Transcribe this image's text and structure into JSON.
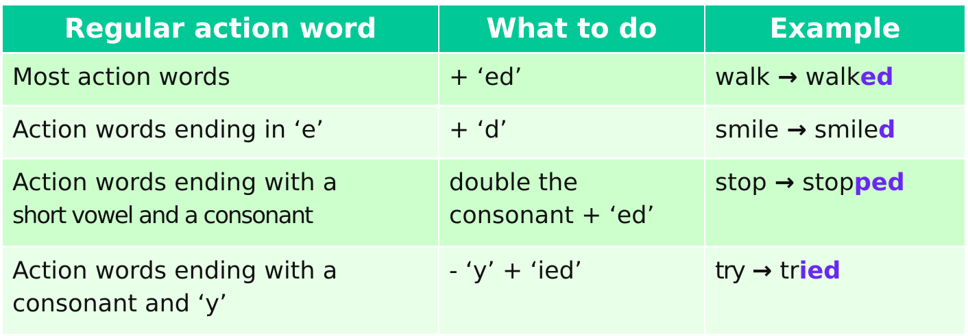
{
  "table": {
    "headers": [
      "Regular action word",
      "What to do",
      "Example"
    ],
    "rows": [
      {
        "word_lines": [
          "Most action words"
        ],
        "todo_lines": [
          "+ ‘ed’"
        ],
        "example": {
          "base": "walk",
          "arrow": "→",
          "stem": "walk",
          "suffix": "ed"
        }
      },
      {
        "word_lines": [
          "Action words ending in ‘e’"
        ],
        "todo_lines": [
          "+ ‘d’"
        ],
        "example": {
          "base": "smile",
          "arrow": "→",
          "stem": "smile",
          "suffix": "d"
        }
      },
      {
        "word_lines": [
          "Action words ending with a",
          "short vowel and a consonant"
        ],
        "todo_lines": [
          "double the",
          "consonant + ‘ed’"
        ],
        "example": {
          "base": "stop",
          "arrow": "→",
          "stem": "stop",
          "suffix": "ped"
        }
      },
      {
        "word_lines": [
          "Action words ending with a",
          "consonant and ‘y’"
        ],
        "todo_lines": [
          "- ‘y’ + ‘ied’"
        ],
        "example": {
          "base": "try",
          "arrow": "→",
          "stem": "tr",
          "suffix": "ied"
        }
      }
    ]
  },
  "colors": {
    "header_bg": "#00c896",
    "row_light": "#e8ffe8",
    "row_dark": "#ccffcc",
    "suffix": "#6a28f0"
  }
}
